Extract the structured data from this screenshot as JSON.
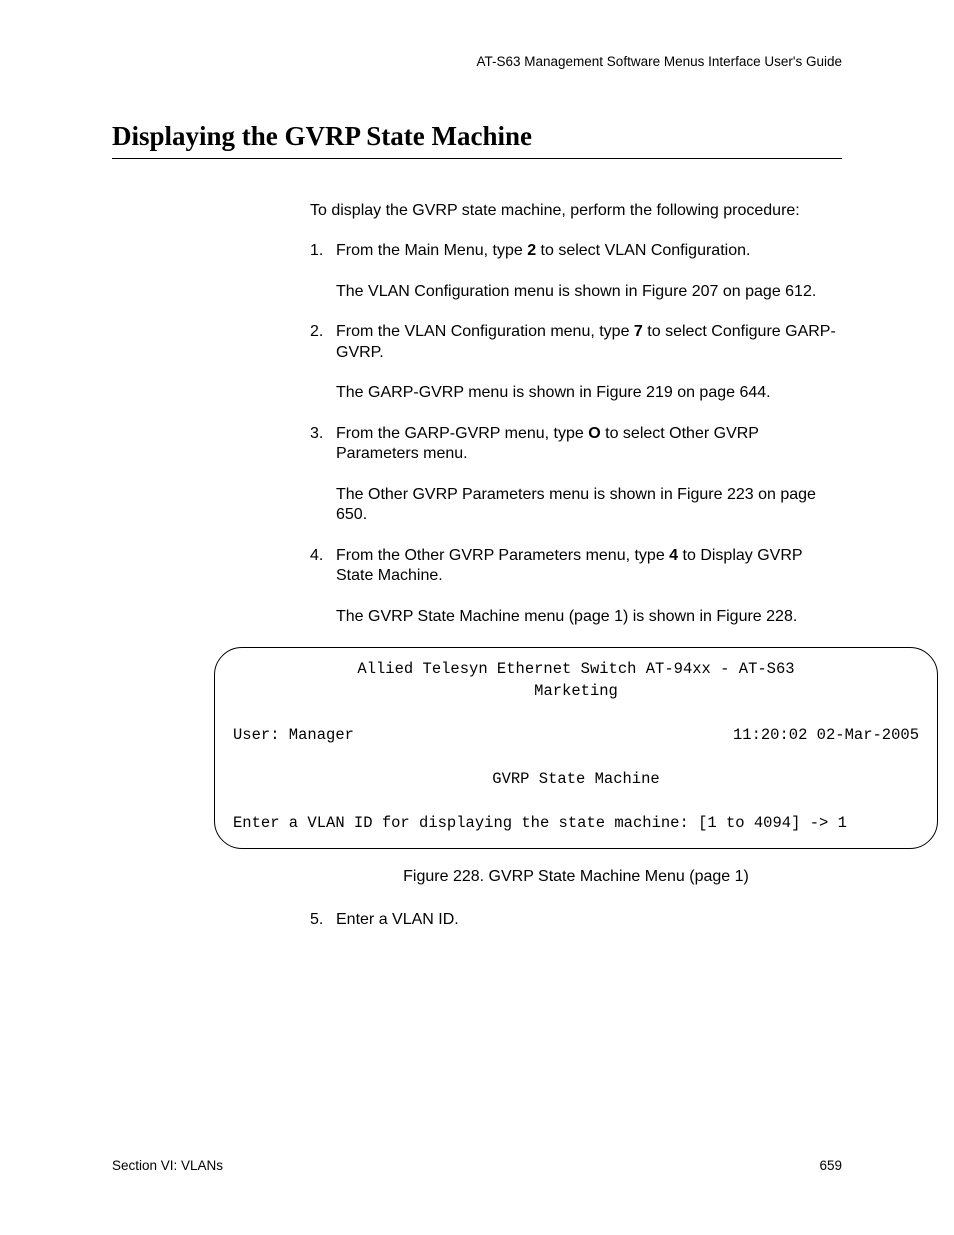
{
  "header": {
    "guide_title": "AT-S63 Management Software Menus Interface User's Guide"
  },
  "section": {
    "title": "Displaying the GVRP State Machine"
  },
  "intro": "To display the GVRP state machine, perform the following procedure:",
  "steps": [
    {
      "pre": "From the Main Menu, type ",
      "key": "2",
      "post": " to select VLAN Configuration.",
      "sub": "The VLAN Configuration menu is shown in Figure 207 on page 612."
    },
    {
      "pre": "From the VLAN Configuration menu, type ",
      "key": "7",
      "post": " to select Configure GARP-GVRP.",
      "sub": "The GARP-GVRP menu is shown in Figure 219 on page 644."
    },
    {
      "pre": "From the GARP-GVRP menu, type ",
      "key": "O",
      "post": " to select Other GVRP Parameters menu.",
      "sub": "The Other GVRP Parameters menu is shown in Figure 223 on page 650."
    },
    {
      "pre": "From the Other GVRP Parameters menu, type ",
      "key": "4",
      "post": " to Display GVRP State Machine.",
      "sub": "The GVRP State Machine menu (page 1) is shown in Figure 228."
    }
  ],
  "terminal": {
    "title_line1": "Allied Telesyn Ethernet Switch AT-94xx - AT-S63",
    "title_line2": "Marketing",
    "user_label": "User: Manager",
    "timestamp": "11:20:02 02-Mar-2005",
    "menu_title": "GVRP State Machine",
    "prompt": "Enter a VLAN ID for displaying the state machine: [1 to 4094] -> 1"
  },
  "figure_caption": "Figure 228. GVRP State Machine Menu (page 1)",
  "step5": "Enter a VLAN ID.",
  "footer": {
    "section": "Section VI: VLANs",
    "page_number": "659"
  }
}
